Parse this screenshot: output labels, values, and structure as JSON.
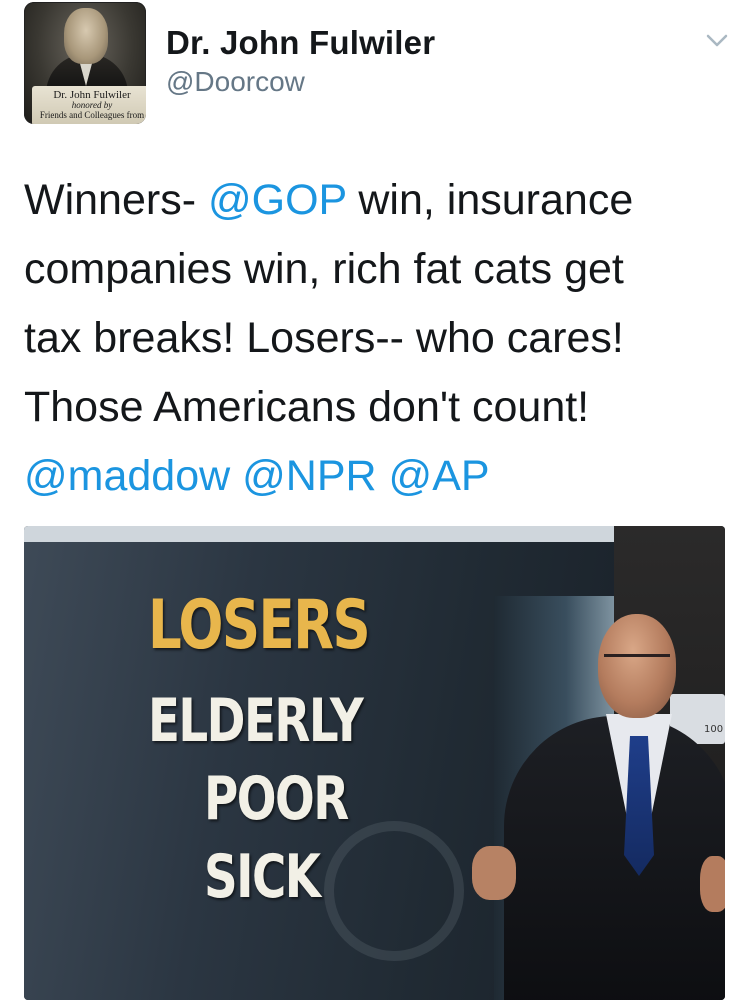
{
  "author": {
    "display_name": "Dr. John Fulwiler",
    "handle": "@Doorcow",
    "avatar": {
      "plaque_name": "Dr. John Fulwiler",
      "plaque_honored": "honored by",
      "plaque_from": "Friends and Colleagues from"
    }
  },
  "tweet": {
    "line1_pre": "Winners- ",
    "line1_mention": "@GOP",
    "line1_post": " win, insurance",
    "line2": "companies win, rich fat cats get",
    "line3": "tax breaks! Losers-- who cares!",
    "line4": "Those Americans don't count!",
    "mention_maddow": "@maddow",
    "mention_npr": "@NPR",
    "mention_ap": "@AP"
  },
  "media": {
    "caption_title": "LOSERS",
    "caption_items": [
      "ELDERLY",
      "POOR",
      "SICK"
    ],
    "monitor_number": "100"
  },
  "colors": {
    "mention": "#1b95e0",
    "text": "#14171a",
    "secondary": "#657786",
    "caption_gold": "#e8b64c"
  },
  "icons": {
    "menu": "chevron-down-icon"
  }
}
